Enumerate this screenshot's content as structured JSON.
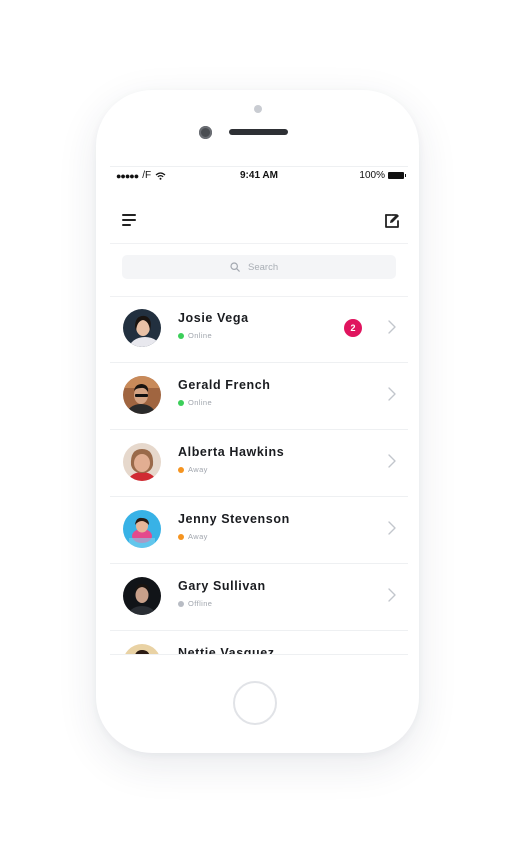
{
  "status_bar": {
    "carrier": "F",
    "time": "9:41 AM",
    "battery": "100%"
  },
  "nav": {
    "menu_icon": "menu-icon",
    "compose_icon": "compose-icon"
  },
  "search": {
    "placeholder": "Search"
  },
  "colors": {
    "online": "#3ccf5a",
    "away": "#f59420",
    "offline": "#b8bcc4",
    "badge": "#e0145e"
  },
  "contacts": [
    {
      "name": "Josie Vega",
      "status": "Online",
      "status_color": "#3ccf5a",
      "badge": "2"
    },
    {
      "name": "Gerald French",
      "status": "Online",
      "status_color": "#3ccf5a",
      "badge": ""
    },
    {
      "name": "Alberta Hawkins",
      "status": "Away",
      "status_color": "#f59420",
      "badge": ""
    },
    {
      "name": "Jenny Stevenson",
      "status": "Away",
      "status_color": "#f59420",
      "badge": ""
    },
    {
      "name": "Gary Sullivan",
      "status": "Offline",
      "status_color": "#b8bcc4",
      "badge": ""
    },
    {
      "name": "Nettie Vasquez",
      "status": "",
      "status_color": "#b8bcc4",
      "badge": ""
    }
  ]
}
